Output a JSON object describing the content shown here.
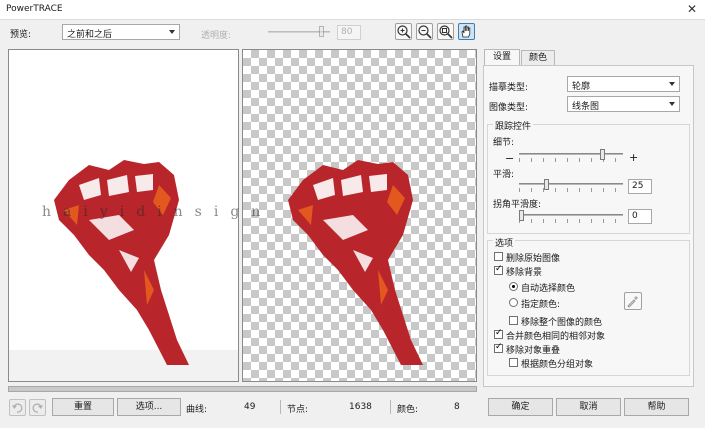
{
  "window": {
    "title": "PowerTRACE",
    "close_icon": "close-icon"
  },
  "toolbar": {
    "preview_label": "预览:",
    "preview_value": "之前和之后",
    "transparency_label": "透明度:",
    "transparency_value": "80",
    "tools": [
      "zoom-in-icon",
      "zoom-out-icon",
      "zoom-fit-icon",
      "pan-hand-icon"
    ]
  },
  "watermark": "haiyidinsign",
  "tabs": [
    "设置",
    "颜色"
  ],
  "settings": {
    "trace_type_label": "描摹类型:",
    "trace_type_value": "轮廓",
    "image_type_label": "图像类型:",
    "image_type_value": "线条图",
    "trace_controls_title": "跟踪控件",
    "detail_label": "细节:",
    "detail_minus": "−",
    "detail_plus": "+",
    "detail_level": 0.82,
    "smoothing_label": "平滑:",
    "smoothing_value": "25",
    "smoothing_level": 0.25,
    "corner_label": "拐角平滑度:",
    "corner_value": "0",
    "corner_level": 0.0
  },
  "options": {
    "title": "选项",
    "delete_original": {
      "label": "删除原始图像",
      "checked": false
    },
    "remove_background": {
      "label": "移除背景",
      "checked": true
    },
    "auto_select_color": {
      "label": "自动选择颜色",
      "selected": true
    },
    "specify_color": {
      "label": "指定颜色:",
      "selected": false
    },
    "remove_color_entire": {
      "label": "移除整个图像的颜色",
      "checked": false
    },
    "merge_adjacent": {
      "label": "合并颜色相同的相邻对象",
      "checked": true
    },
    "remove_overlap": {
      "label": "移除对象重叠",
      "checked": true
    },
    "group_by_color": {
      "label": "根据颜色分组对象",
      "checked": false
    }
  },
  "footer": {
    "reset_label": "重置",
    "options_label": "选项...",
    "curves_label": "曲线:",
    "curves_value": "49",
    "nodes_label": "节点:",
    "nodes_value": "1638",
    "colors_label": "颜色:",
    "colors_value": "8",
    "ok_label": "确定",
    "cancel_label": "取消",
    "help_label": "帮助"
  },
  "colors": {
    "fist_red": "#b8262b",
    "fist_orange": "#e2581f",
    "accent_blue": "#3c7fb1"
  }
}
